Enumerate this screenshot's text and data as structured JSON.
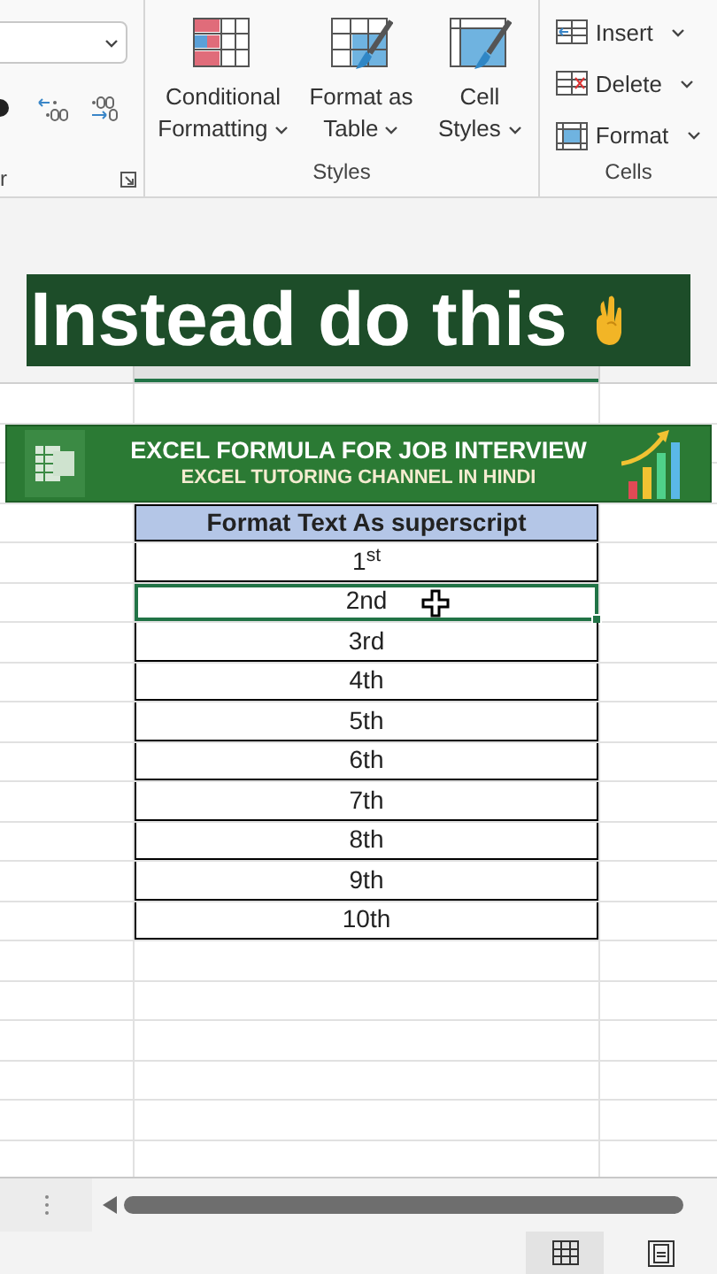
{
  "ribbon": {
    "number_group": {
      "label": "r"
    },
    "styles_group": {
      "label": "Styles",
      "buttons": [
        {
          "kind": "conditional",
          "label": "Conditional Formatting"
        },
        {
          "kind": "table",
          "label": "Format as Table"
        },
        {
          "kind": "styles",
          "label": "Cell Styles"
        }
      ]
    },
    "cells_group": {
      "label": "Cells",
      "buttons": [
        {
          "kind": "insert",
          "label": "Insert"
        },
        {
          "kind": "delete",
          "label": "Delete"
        },
        {
          "kind": "format",
          "label": "Format"
        }
      ]
    }
  },
  "caption": {
    "text": "Instead do this"
  },
  "banner": {
    "title": "EXCEL FORMULA FOR JOB INTERVIEW",
    "subtitle": "EXCEL TUTORING CHANNEL IN HINDI"
  },
  "table": {
    "header": "Format Text As superscript",
    "rows": [
      {
        "value": "1$^{st}$",
        "selected": false
      },
      {
        "value": "2nd",
        "selected": true
      },
      {
        "value": "3rd",
        "selected": false
      },
      {
        "value": "4th",
        "selected": false
      },
      {
        "value": "5th",
        "selected": false
      },
      {
        "value": "6th",
        "selected": false
      },
      {
        "value": "7th",
        "selected": false
      },
      {
        "value": "8th",
        "selected": false
      },
      {
        "value": "9th",
        "selected": false
      },
      {
        "value": "10th",
        "selected": false
      }
    ]
  },
  "status_bar": {
    "views": [
      {
        "kind": "normal",
        "selected": true
      },
      {
        "kind": "page",
        "selected": false
      }
    ]
  }
}
